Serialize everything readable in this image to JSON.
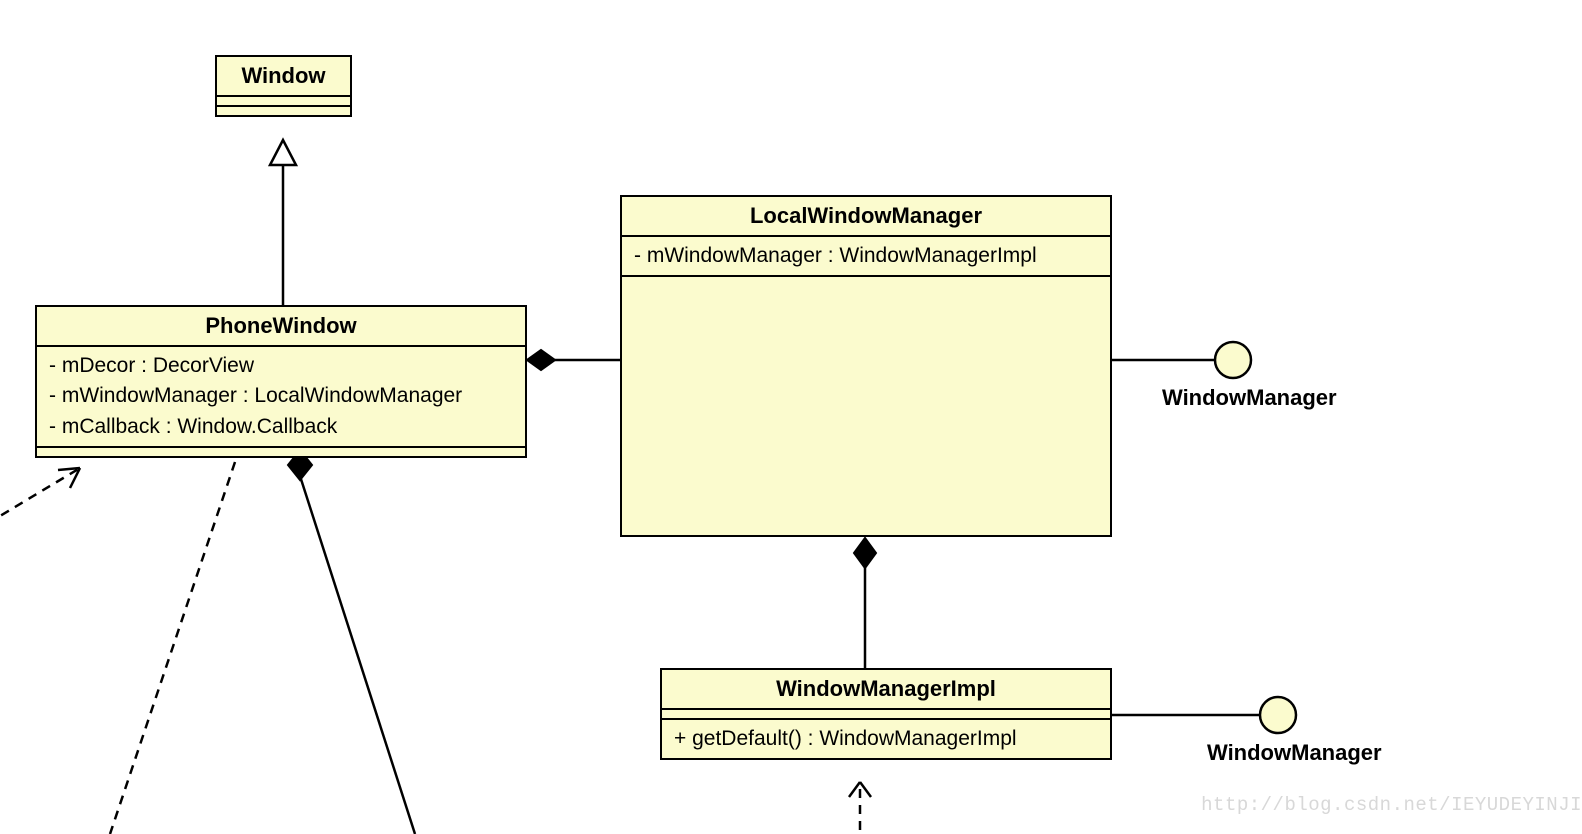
{
  "classes": {
    "window": {
      "name": "Window"
    },
    "phoneWindow": {
      "name": "PhoneWindow",
      "attrs": [
        "- mDecor : DecorView",
        "- mWindowManager : LocalWindowManager",
        "- mCallback : Window.Callback"
      ]
    },
    "localWindowManager": {
      "name": "LocalWindowManager",
      "attrs": [
        "- mWindowManager : WindowManagerImpl"
      ]
    },
    "windowManagerImpl": {
      "name": "WindowManagerImpl",
      "methods": [
        "+ getDefault() : WindowManagerImpl"
      ]
    }
  },
  "interfaces": {
    "wm1": "WindowManager",
    "wm2": "WindowManager"
  },
  "watermark": "http://blog.csdn.net/IEYUDEYINJI"
}
